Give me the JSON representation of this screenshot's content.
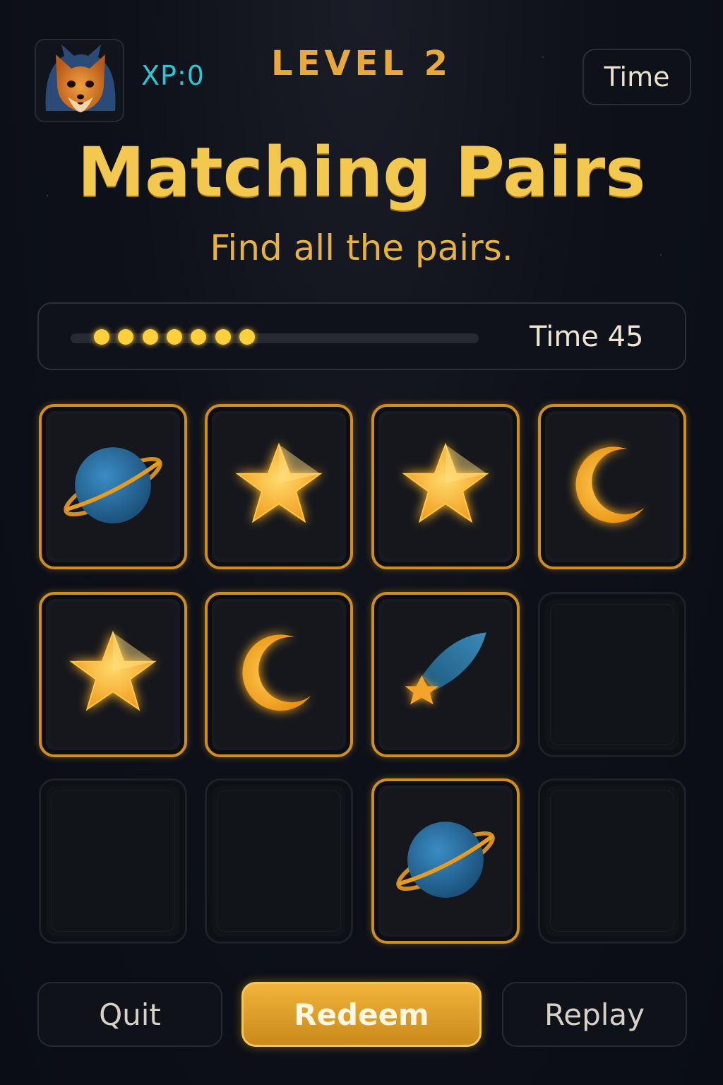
{
  "header": {
    "xp_label": "XP:0",
    "level_label": "LEVEL 2",
    "time_button_label": "Time",
    "avatar_icon": "fox-avatar-icon"
  },
  "title": "Matching Pairs",
  "subtitle": "Find all the pairs.",
  "progress": {
    "dots_filled": 7,
    "time_label": "Time",
    "time_value": "45"
  },
  "grid": {
    "rows": 3,
    "cols": 4,
    "tiles": [
      {
        "state": "revealed",
        "icon": "planet-icon"
      },
      {
        "state": "revealed",
        "icon": "star-icon"
      },
      {
        "state": "revealed",
        "icon": "star-icon"
      },
      {
        "state": "revealed",
        "icon": "moon-icon"
      },
      {
        "state": "revealed",
        "icon": "star-icon"
      },
      {
        "state": "revealed",
        "icon": "moon-icon"
      },
      {
        "state": "revealed",
        "icon": "comet-icon"
      },
      {
        "state": "hidden",
        "icon": ""
      },
      {
        "state": "hidden",
        "icon": ""
      },
      {
        "state": "hidden",
        "icon": ""
      },
      {
        "state": "revealed",
        "icon": "planet-icon"
      },
      {
        "state": "hidden",
        "icon": ""
      }
    ]
  },
  "buttons": {
    "quit": "Quit",
    "redeem": "Redeem",
    "replay": "Replay"
  },
  "colors": {
    "accent_gold": "#e8a83a",
    "xp_cyan": "#27c8d6",
    "tile_border": "#d08f1c",
    "background": "#0c0f18"
  }
}
